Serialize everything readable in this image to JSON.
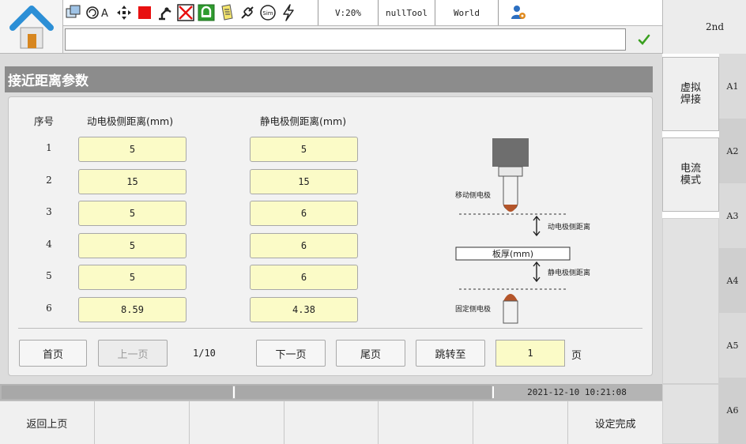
{
  "toolbar": {
    "status": {
      "speed": "V:20%",
      "tool": "nullTool",
      "coord": "World"
    },
    "mode": "2nd",
    "sim_label": "Sim"
  },
  "panel": {
    "title": "接近距离参数",
    "headers": {
      "index": "序号",
      "moving": "动电极侧距离(mm)",
      "fixed": "静电极侧距离(mm)"
    },
    "rows": [
      {
        "index": "1",
        "moving": "5",
        "fixed": "5"
      },
      {
        "index": "2",
        "moving": "15",
        "fixed": "15"
      },
      {
        "index": "3",
        "moving": "5",
        "fixed": "6"
      },
      {
        "index": "4",
        "moving": "5",
        "fixed": "6"
      },
      {
        "index": "5",
        "moving": "5",
        "fixed": "6"
      },
      {
        "index": "6",
        "moving": "8.59",
        "fixed": "4.38"
      }
    ],
    "diagram": {
      "moving_electrode": "移动侧电极",
      "moving_distance": "动电极侧距离",
      "plate": "板厚(mm)",
      "fixed_distance": "静电极侧距离",
      "fixed_electrode": "固定侧电极"
    },
    "pagination": {
      "first": "首页",
      "prev": "上一页",
      "indicator": "1/10",
      "next": "下一页",
      "last": "尾页",
      "jump": "跳转至",
      "jump_value": "1",
      "unit": "页"
    }
  },
  "status_bar": {
    "datetime": "2021-12-10 10:21:08"
  },
  "function_keys": [
    "返回上页",
    "",
    "",
    "",
    "",
    "",
    "设定完成"
  ],
  "right_tabs": [
    {
      "line1": "虚拟",
      "line2": "焊接"
    },
    {
      "line1": "电流",
      "line2": "模式"
    }
  ],
  "side_keys": [
    "A1",
    "A2",
    "A3",
    "A4",
    "A5",
    "A6"
  ],
  "colors": {
    "input_bg": "#fbfbc7",
    "title_bar": "#8c8c8c",
    "electrode_tip": "#b4552a",
    "stop_red": "#e81010",
    "check_green": "#3aa020"
  }
}
